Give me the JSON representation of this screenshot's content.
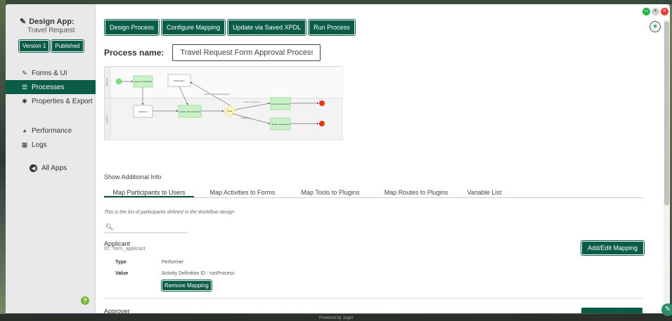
{
  "app": {
    "title": "Design App:",
    "subtitle": "Travel Request",
    "version_badge": "Version 1",
    "status_badge": "Published"
  },
  "sidebar": {
    "items": [
      {
        "label": "Forms & UI",
        "icon": "edit-icon"
      },
      {
        "label": "Processes",
        "icon": "list-icon",
        "active": true
      },
      {
        "label": "Properties & Export",
        "icon": "gear-icon"
      },
      {
        "label": "Performance",
        "icon": "dashboard-icon"
      },
      {
        "label": "Logs",
        "icon": "logs-icon"
      }
    ],
    "all_apps": "All Apps"
  },
  "toolbar": {
    "design_process": "Design Process",
    "configure_mapping": "Configure Mapping",
    "update_xpdl": "Update via Saved XPDL",
    "run_process": "Run Process"
  },
  "process": {
    "name_label": "Process name:",
    "name_value": "Travel Request Form Approval Process"
  },
  "diagram": {
    "lanes": [
      "Approver",
      "Applicant"
    ],
    "nodes": {
      "approval_required": "Approval Required",
      "clarification": "Clarification",
      "applicant": "Applicant",
      "update_record": "Update Record Status",
      "route": "Route",
      "email_approved": "Email on Approved",
      "email_rejected": "Email on Rejected"
    },
    "conditions": {
      "clarification": "status == \"Clarification Required\"",
      "approved": "status == \"Approved\"",
      "otherwise": "(otherwise)"
    }
  },
  "additional_info": "Show Additional Info",
  "tabs": [
    {
      "label": "Map Participants to Users",
      "active": true
    },
    {
      "label": "Map Activities to Forms"
    },
    {
      "label": "Map Tools to Plugins"
    },
    {
      "label": "Map Routes to Plugins"
    },
    {
      "label": "Variable List"
    }
  ],
  "participants": {
    "description": "This is the list of participants defined in the Workflow design",
    "search_placeholder": "",
    "first": {
      "name": "Applicant",
      "id": "ID : form_applicant",
      "type_label": "Type",
      "type_value": "Performer",
      "value_label": "Value",
      "value_value": "Activity Definition ID : runProcess",
      "remove_label": "Remove Mapping",
      "add_edit_label": "Add/Edit Mapping"
    },
    "second": {
      "name": "Approver"
    }
  },
  "footer": {
    "powered": "Powered by Joget"
  },
  "colors": {
    "accent": "#0b5c47",
    "green_node": "#c9f2c9",
    "end_node": "#e8380d",
    "start_node": "#7de07d"
  }
}
